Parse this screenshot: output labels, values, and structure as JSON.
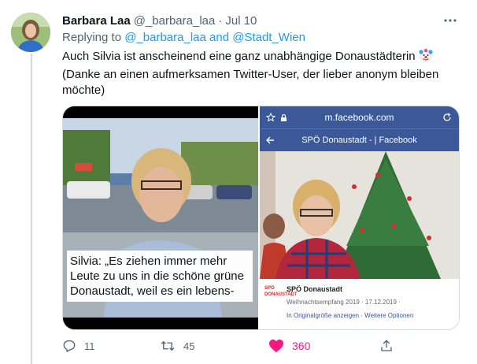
{
  "tweet": {
    "author_name": "Barbara Laa",
    "author_handle": "@_barbara_laa",
    "separator": "·",
    "date": "Jul 10",
    "replying_prefix": "Replying to",
    "replying_to": "@_barbara_laa and @Stadt_Wien",
    "text_line1": "Auch Silvia ist anscheinend eine ganz unabhängige Donaustädterin",
    "text_line2": "(Danke an einen aufmerksamen Twitter-User, der lieber anonym bleiben",
    "text_line3": "möchte)",
    "emoji": "clown-face"
  },
  "media": {
    "left_caption": [
      "Silvia: „Es ziehen immer mehr",
      "Leute zu uns in die schöne grüne",
      "Donaustadt, weil es ein lebens-"
    ],
    "right": {
      "browser_url": "m.facebook.com",
      "page_header": "SPÖ Donaustadt - | Facebook",
      "page_name": "SPÖ Donaustadt",
      "post_meta": "Weihnachtsempfang 2019 · 17.12.2019 · ",
      "post_links": "In Originalgröße anzeigen · Weitere Optionen",
      "logo_text": "SPÖ DONAUSTADT"
    }
  },
  "actions": {
    "reply_count": "11",
    "retweet_count": "45",
    "like_count": "360"
  },
  "colors": {
    "link": "#1d9bf0",
    "secondary_text": "#536471",
    "like": "#f91880",
    "facebook_blue": "#3b5998"
  }
}
